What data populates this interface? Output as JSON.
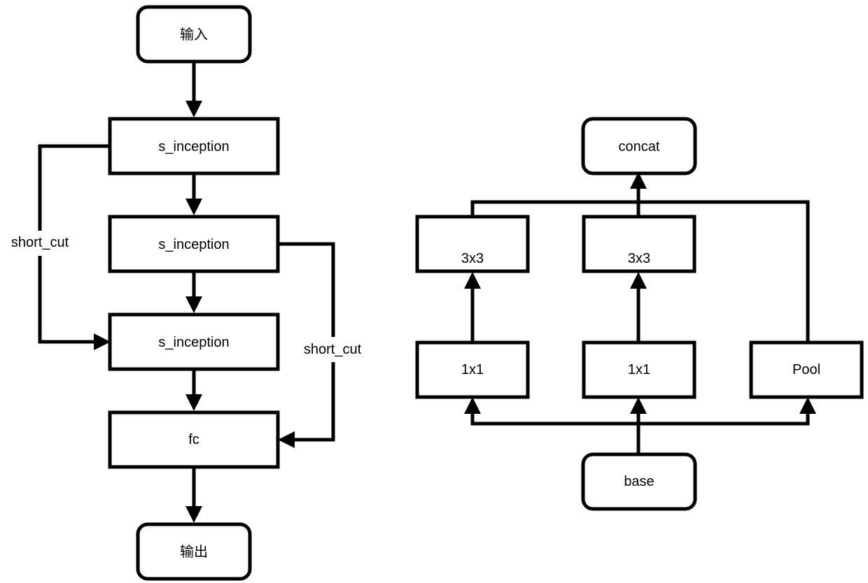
{
  "left_diagram": {
    "nodes": {
      "input": "输入",
      "s_inception_1": "s_inception",
      "s_inception_2": "s_inception",
      "s_inception_3": "s_inception",
      "fc": "fc",
      "output": "输出"
    },
    "edge_labels": {
      "shortcut_left": "short_cut",
      "shortcut_right": "short_cut"
    }
  },
  "right_diagram": {
    "nodes": {
      "concat": "concat",
      "conv3x3_left": "3x3",
      "conv3x3_mid": "3x3",
      "conv1x1_left": "1x1",
      "conv1x1_mid": "1x1",
      "pool": "Pool",
      "base": "base"
    }
  },
  "colors": {
    "stroke": "#000000",
    "fill": "#ffffff"
  }
}
